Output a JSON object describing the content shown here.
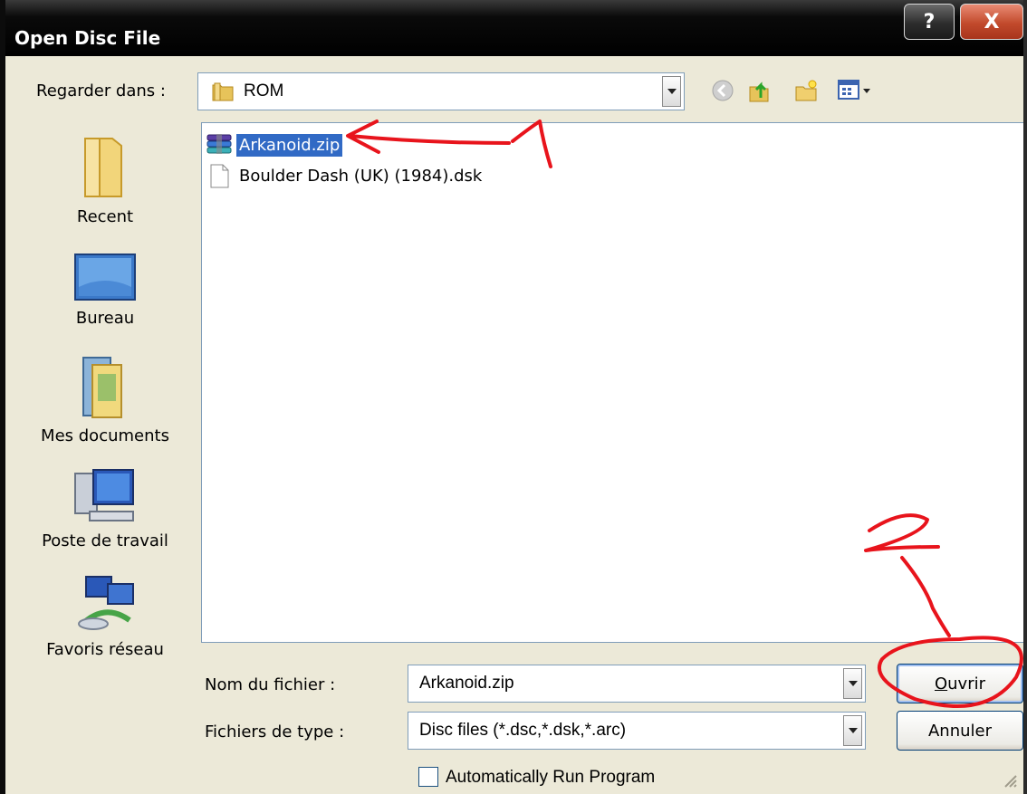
{
  "window": {
    "title": "Open Disc File",
    "help_label": "?",
    "close_label": "X"
  },
  "look_in": {
    "label": "Regarder dans :",
    "value": "ROM"
  },
  "places": [
    {
      "label": "Recent",
      "icon": "recent-folder-icon"
    },
    {
      "label": "Bureau",
      "icon": "desktop-icon"
    },
    {
      "label": "Mes documents",
      "icon": "documents-icon"
    },
    {
      "label": "Poste de travail",
      "icon": "computer-icon"
    },
    {
      "label": "Favoris réseau",
      "icon": "network-icon"
    }
  ],
  "files": [
    {
      "name": "Arkanoid.zip",
      "icon": "zip-archive-icon",
      "selected": true
    },
    {
      "name": "Boulder Dash (UK) (1984).dsk",
      "icon": "file-icon",
      "selected": false
    }
  ],
  "filename": {
    "label": "Nom du fichier :",
    "value": "Arkanoid.zip"
  },
  "filetype": {
    "label": "Fichiers de type :",
    "value": "Disc files (*.dsc,*.dsk,*.arc)"
  },
  "buttons": {
    "open_first": "O",
    "open_rest": "uvrir",
    "cancel": "Annuler"
  },
  "auto_run": {
    "label": "Automatically Run Program",
    "checked": false
  },
  "annotations": {
    "mark_1": "1",
    "mark_2": "2",
    "color": "#e8141c"
  },
  "colors": {
    "selection": "#316ac5",
    "dialog_bg": "#ece9d8",
    "titlebar": "#000000"
  }
}
